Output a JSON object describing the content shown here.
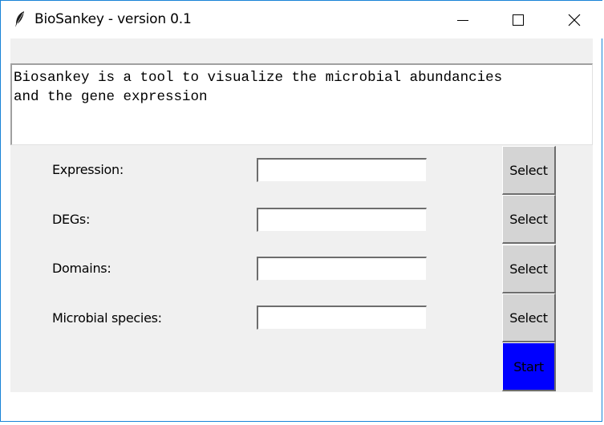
{
  "window": {
    "title": "BioSankey - version 0.1",
    "app_icon": "feather-icon",
    "controls": {
      "minimize_icon": "minimize-icon",
      "maximize_icon": "maximize-icon",
      "close_icon": "close-icon",
      "close_glyph": "✕"
    }
  },
  "description": {
    "text": "Biosankey is a tool to visualize the microbial abundancies\nand the gene expression"
  },
  "form": {
    "fields": [
      {
        "label": "Expression:",
        "value": "",
        "button_label": "Select"
      },
      {
        "label": "DEGs:",
        "value": "",
        "button_label": "Select"
      },
      {
        "label": "Domains:",
        "value": "",
        "button_label": "Select"
      },
      {
        "label": "Microbial species:",
        "value": "",
        "button_label": "Select"
      }
    ],
    "start_label": "Start"
  },
  "colors": {
    "start_button": "#0000ff",
    "form_background": "#f0f0f0",
    "button_background": "#d4d4d4",
    "window_border": "#1883d7"
  }
}
